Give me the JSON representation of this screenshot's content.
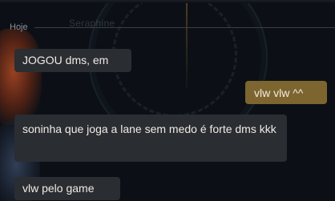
{
  "chat": {
    "background_name": "Seraphine",
    "date_divider": "Hoje",
    "colors": {
      "incoming_bubble": "#2a2d32",
      "outgoing_bubble": "#7d6530",
      "divider": "#3a3f46"
    },
    "messages": [
      {
        "direction": "incoming",
        "text": "JOGOU dms, em"
      },
      {
        "direction": "outgoing",
        "text": "vlw vlw ^^"
      },
      {
        "direction": "incoming",
        "text": "soninha que joga a lane sem medo é forte dms kkk"
      },
      {
        "direction": "incoming",
        "text": "vlw pelo game"
      }
    ]
  }
}
